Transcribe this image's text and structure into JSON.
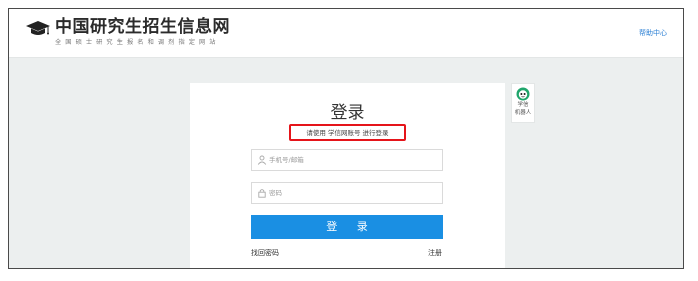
{
  "header": {
    "site_title": "中国研究生招生信息网",
    "site_subtitle": "全国硕士研究生报名和调剂指定网站",
    "help_link": "帮助中心"
  },
  "login": {
    "title": "登录",
    "hint": "请使用 学信网账号 进行登录",
    "phone_placeholder": "手机号/邮箱",
    "password_placeholder": "密码",
    "submit_label": "登 录",
    "forgot_link": "找回密码",
    "register_link": "注册"
  },
  "robot": {
    "label_line1": "学信",
    "label_line2": "机器人"
  },
  "colors": {
    "accent": "#1a8fe3",
    "highlight_box": "#e5141a",
    "background": "#ecefef",
    "link": "#2a7fd4"
  },
  "icons": [
    "graduation-cap-icon",
    "user-icon",
    "lock-icon",
    "robot-icon"
  ]
}
